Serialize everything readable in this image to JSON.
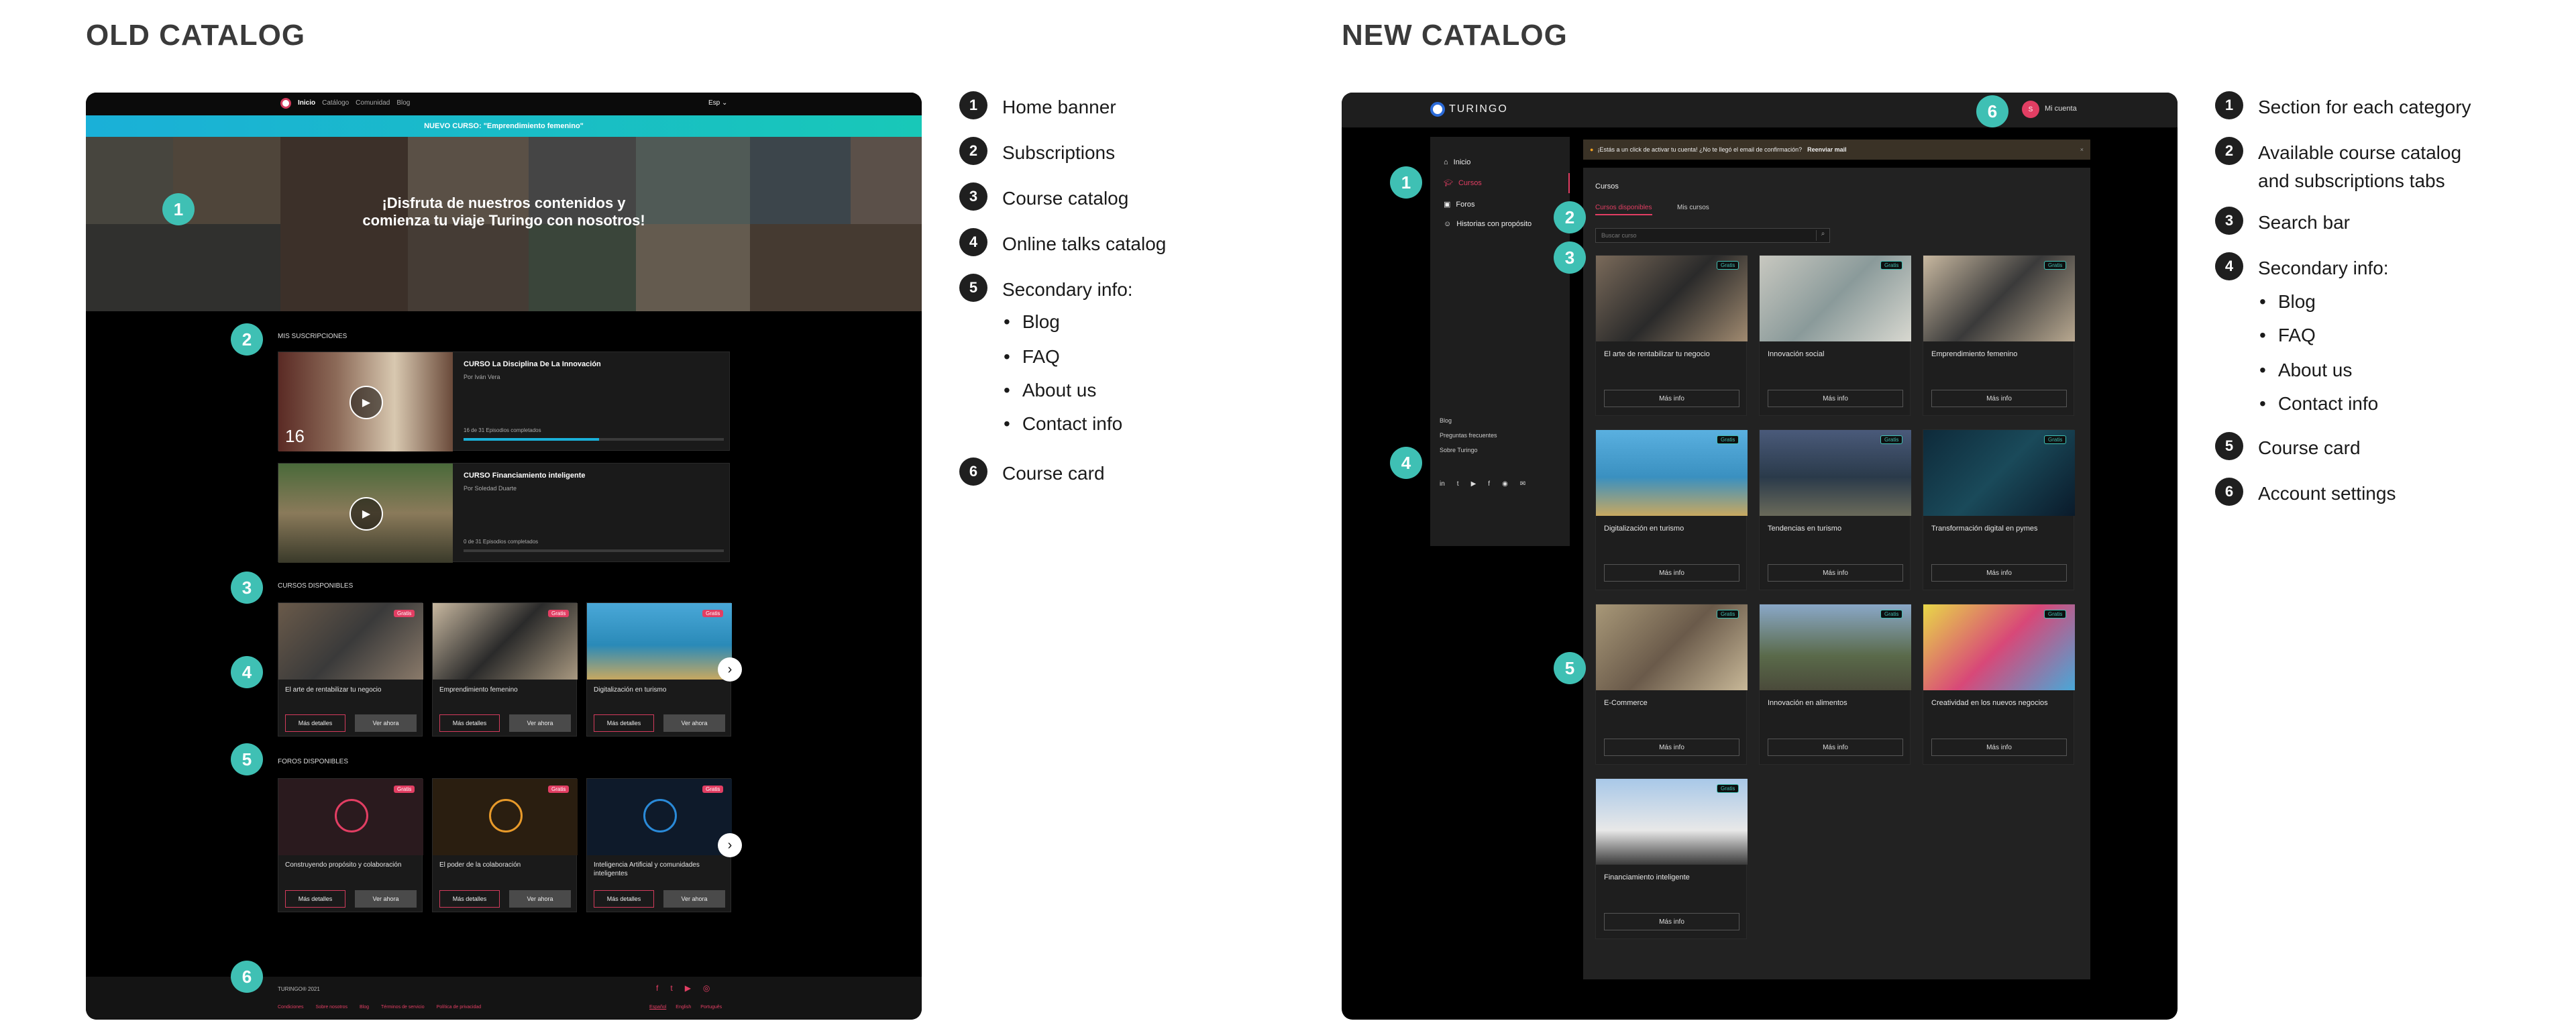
{
  "old": {
    "heading": "OLD CATALOG",
    "nav": [
      "Inicio",
      "Catálogo",
      "Comunidad",
      "Blog"
    ],
    "lang": "Esp",
    "banner_strip": "NUEVO CURSO: \"Emprendimiento femenino\"",
    "hero_line1": "¡Disfruta de nuestros contenidos y",
    "hero_line2": "comienza tu viaje Turingo con nosotros!",
    "subs_title": "MIS SUSCRIPCIONES",
    "subs": [
      {
        "title": "CURSO La Disciplina De La Innovación",
        "author": "Por Iván Vera",
        "progress_text": "16 de 31 Episodios completados",
        "progress": 0.52,
        "thumb_num": "16"
      },
      {
        "title": "CURSO Financiamiento inteligente",
        "author": "Por Soledad Duarte",
        "progress_text": "0 de 31 Episodios completados",
        "progress": 0.0
      }
    ],
    "courses_title": "CURSOS DISPONIBLES",
    "courses": [
      {
        "title": "El arte de rentabilizar tu negocio",
        "badge": "Gratis"
      },
      {
        "title": "Emprendimiento femenino",
        "badge": "Gratis"
      },
      {
        "title": "Digitalización en turismo",
        "badge": "Gratis"
      }
    ],
    "forums_title": "FOROS DISPONIBLES",
    "forums": [
      {
        "title": "Construyendo propósito y colaboración",
        "badge": "Gratis"
      },
      {
        "title": "El poder de la colaboración",
        "badge": "Gratis"
      },
      {
        "title": "Inteligencia Artificial y comunidades inteligentes",
        "badge": "Gratis"
      }
    ],
    "more_btn": "Más detalles",
    "watch_btn": "Ver ahora",
    "footer_brand": "TURINGO® 2021",
    "footer_links": [
      "Condiciones",
      "Sobre nosotros",
      "Blog",
      "Términos de servicio",
      "Política de privacidad"
    ],
    "footer_langs": [
      "Español",
      "English",
      "Português"
    ]
  },
  "old_legend": [
    {
      "n": "1",
      "label": "Home banner"
    },
    {
      "n": "2",
      "label": "Subscriptions"
    },
    {
      "n": "3",
      "label": "Course catalog"
    },
    {
      "n": "4",
      "label": "Online talks catalog"
    },
    {
      "n": "5",
      "label": "Secondary info:"
    },
    {
      "n": "6",
      "label": "Course card"
    }
  ],
  "old_sub": [
    "Blog",
    "FAQ",
    "About us",
    "Contact info"
  ],
  "new": {
    "heading": "NEW CATALOG",
    "brand": "TURINGO",
    "account": "Mi cuenta",
    "alert": "¡Estás a un click de activar tu cuenta! ¿No te llegó el email de confirmación?",
    "alert_action": "Reenviar mail",
    "sidebar": [
      "Inicio",
      "Cursos",
      "Foros",
      "Historias con propósito"
    ],
    "sidebar_footer": [
      "Blog",
      "Preguntas frecuentes",
      "Sobre Turingo"
    ],
    "section_title": "Cursos",
    "tabs": [
      "Cursos disponibles",
      "Mis cursos"
    ],
    "search_placeholder": "Buscar curso",
    "more_btn": "Más info",
    "badge": "Gratis",
    "courses": [
      "El arte de rentabilizar tu negocio",
      "Innovación social",
      "Emprendimiento femenino",
      "Digitalización en turismo",
      "Tendencias en turismo",
      "Transformación digital en pymes",
      "E-Commerce",
      "Innovación en alimentos",
      "Creatividad en los nuevos negocios",
      "Financiamiento inteligente"
    ]
  },
  "new_legend": [
    {
      "n": "1",
      "label": "Section for each category"
    },
    {
      "n": "2",
      "label": "Available course catalog"
    },
    {
      "n": "3",
      "label": "Search bar"
    },
    {
      "n": "4",
      "label": "Secondary info:"
    },
    {
      "n": "5",
      "label": "Course card"
    },
    {
      "n": "6",
      "label": "Account settings"
    }
  ],
  "new_legend_2b": "and subscriptions tabs",
  "new_sub": [
    "Blog",
    "FAQ",
    "About us",
    "Contact info"
  ],
  "markers_old": [
    "1",
    "2",
    "3",
    "4",
    "5",
    "6"
  ],
  "markers_new": [
    "1",
    "2",
    "3",
    "4",
    "5",
    "6"
  ],
  "colors": {
    "teal": "#3fc0b4",
    "accent": "#e23e63",
    "banner": "#1ab0d8"
  }
}
